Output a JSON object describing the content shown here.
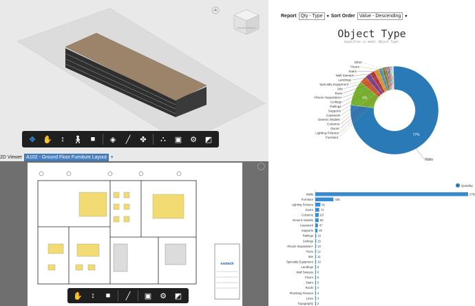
{
  "viewer3d": {
    "viewcube_face": "FRONT RIGHT",
    "toolbar_left": [
      "orbit-icon",
      "pan-icon",
      "zoom-icon",
      "walk-icon",
      "camera-icon"
    ],
    "toolbar_mid": [
      "section-icon",
      "measure-icon",
      "explode-icon"
    ],
    "toolbar_right": [
      "model-browser-icon",
      "properties-icon",
      "settings-icon",
      "fullscreen-icon"
    ]
  },
  "viewer2d": {
    "label": "2D Viewer",
    "sheet": "A102 - Ground Floor Furniture Layout",
    "toolbar": [
      "pan-icon",
      "zoom-icon",
      "camera-icon",
      "measure-icon",
      "properties-icon",
      "settings-icon",
      "fullscreen-icon"
    ],
    "title_block_text": "exotech"
  },
  "report": {
    "report_label": "Report",
    "report_value": "Qty - Type",
    "sort_label": "Sort Order",
    "sort_value": "Value - Descending",
    "title": "Object Type",
    "subtitle": "Quantities in model (Object Type)"
  },
  "pie_labels": [
    "Other",
    "Floors",
    "Stairs",
    "Wall Sweeps",
    "Landings",
    "Specialty Equipment",
    "Site",
    "Runs",
    "<Room Separation>",
    "Ceilings",
    "Railings",
    "Supports",
    "Casework",
    "Generic Models",
    "Columns",
    "Doors",
    "Lighting Fixtures",
    "Furniture",
    "Walls"
  ],
  "colors": {
    "accent": "#2a7ab8",
    "green": "#77b52c",
    "toolbar": "#1f1f1f",
    "select": "#4a7fc0"
  },
  "chart_data": [
    {
      "type": "pie",
      "title": "Object Type",
      "subtitle": "Quantities in model (Object Type)",
      "slices": [
        {
          "label": "Walls",
          "value": 2750,
          "pct_label": "77%"
        },
        {
          "label": "Furniture",
          "value": 326,
          "pct_label": "9%"
        },
        {
          "label": "Lighting Fixtures",
          "value": 91
        },
        {
          "label": "Doors",
          "value": 71
        },
        {
          "label": "Columns",
          "value": 63
        },
        {
          "label": "Generic Models",
          "value": 60
        },
        {
          "label": "Casework",
          "value": 47
        },
        {
          "label": "Supports",
          "value": 40
        },
        {
          "label": "Railings",
          "value": 16
        },
        {
          "label": "Ceilings",
          "value": 15
        },
        {
          "label": "<Room Separation>",
          "value": 13
        },
        {
          "label": "Runs",
          "value": 12
        },
        {
          "label": "Site",
          "value": 11
        },
        {
          "label": "Specialty Equipment",
          "value": 10
        },
        {
          "label": "Landings",
          "value": 6
        },
        {
          "label": "Wall Sweeps",
          "value": 6
        },
        {
          "label": "Stairs",
          "value": 5
        },
        {
          "label": "Floors",
          "value": 4
        },
        {
          "label": "Other",
          "value": 13
        }
      ]
    },
    {
      "type": "bar",
      "orientation": "horizontal",
      "legend": "Quantity",
      "categories": [
        "Walls",
        "Furniture",
        "Lighting Fixtures",
        "Doors",
        "Columns",
        "Generic Models",
        "Casework",
        "Supports",
        "Railings",
        "Ceilings",
        "<Room Separation>",
        "Runs",
        "Site",
        "Specialty Equipment",
        "Landings",
        "Wall Sweeps",
        "Floors",
        "Stairs",
        "Roofs",
        "Plumbing Fixtures",
        "Lines",
        "Topography"
      ],
      "values": [
        2750,
        326,
        91,
        71,
        63,
        60,
        47,
        40,
        16,
        15,
        13,
        12,
        11,
        10,
        6,
        6,
        6,
        5,
        4,
        4,
        3,
        2
      ],
      "xlim": [
        0,
        2800
      ]
    }
  ]
}
